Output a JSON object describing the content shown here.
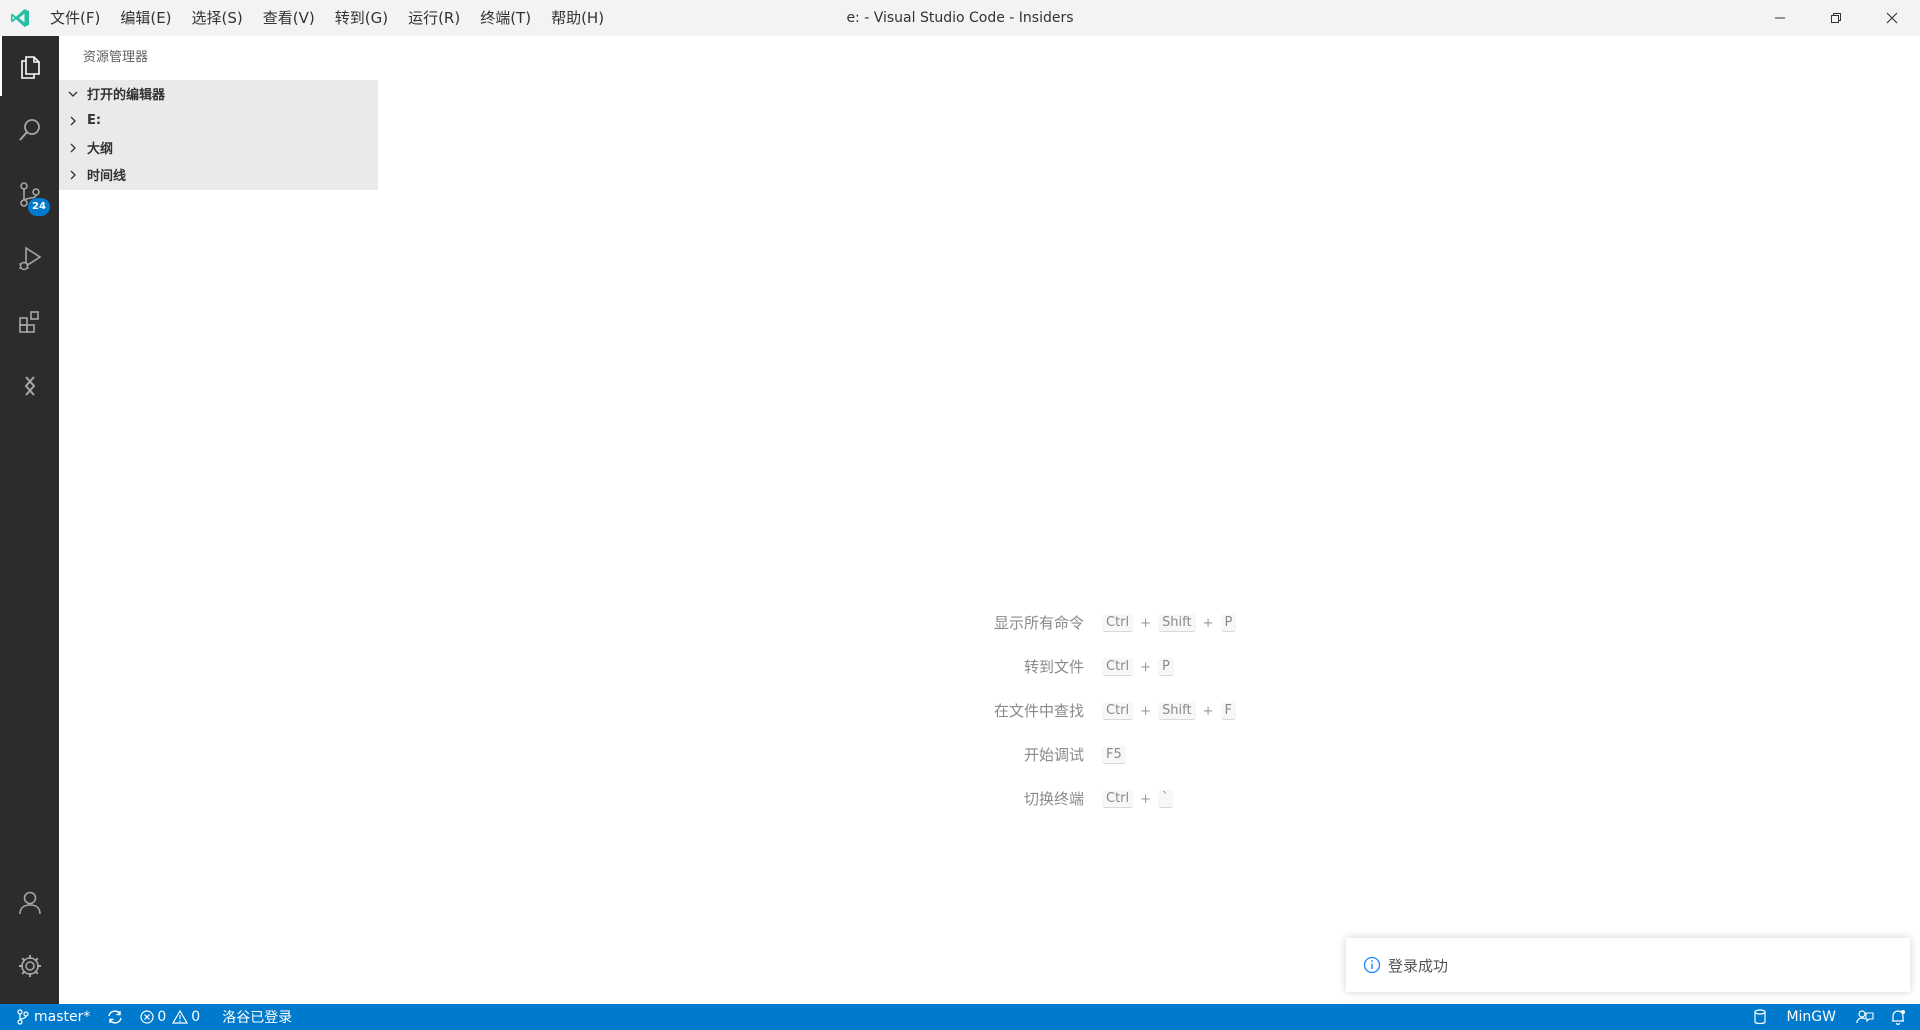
{
  "titlebar": {
    "menu": [
      "文件(F)",
      "编辑(E)",
      "选择(S)",
      "查看(V)",
      "转到(G)",
      "运行(R)",
      "终端(T)",
      "帮助(H)"
    ],
    "window_title": "e: - Visual Studio Code - Insiders"
  },
  "activitybar": {
    "scm_badge": "24"
  },
  "sidebar": {
    "title": "资源管理器",
    "sections": [
      "打开的编辑器",
      "E:",
      "大纲",
      "时间线"
    ]
  },
  "editor": {
    "shortcuts": [
      {
        "label": "显示所有命令",
        "keys": [
          "Ctrl",
          "Shift",
          "P"
        ]
      },
      {
        "label": "转到文件",
        "keys": [
          "Ctrl",
          "P"
        ]
      },
      {
        "label": "在文件中查找",
        "keys": [
          "Ctrl",
          "Shift",
          "F"
        ]
      },
      {
        "label": "开始调试",
        "keys": [
          "F5"
        ]
      },
      {
        "label": "切换终端",
        "keys": [
          "Ctrl",
          "`"
        ]
      }
    ]
  },
  "notification": {
    "message": "登录成功"
  },
  "statusbar": {
    "branch": "master*",
    "errors": "0",
    "warnings": "0",
    "account": "洛谷已登录",
    "terminal": "MinGW"
  },
  "colors": {
    "accent": "#007acc",
    "activitybar": "#2c2c2c",
    "logo": "#24bfa5"
  }
}
